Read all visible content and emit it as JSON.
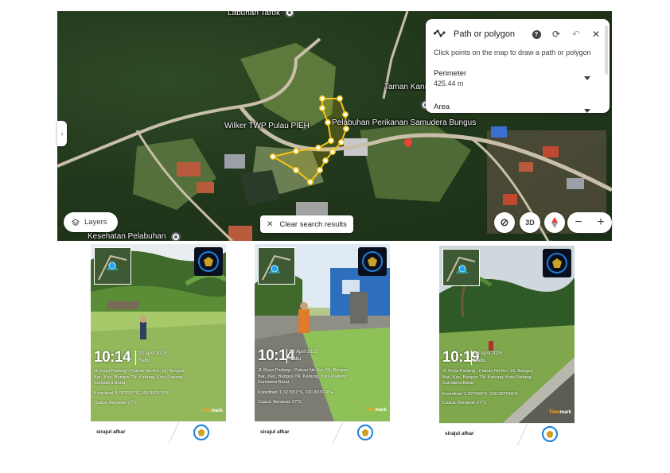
{
  "map": {
    "labels": {
      "labuhan_tarok": "Labuhan Tarok",
      "taman_kana": "Taman Kana",
      "wilker": "Wilker TWP Pulau PIEH",
      "pelabuhan": "Pelabuhan Perikanan Samudera Bungus",
      "kesehatan": "Kesehatan Pelabuhan"
    },
    "measure_panel": {
      "title": "Path or polygon",
      "hint": "Click points on the map to draw a path or polygon",
      "perimeter_label": "Perimeter",
      "perimeter_value": "425.44 m",
      "area_label": "Area"
    },
    "layers_label": "Layers",
    "clear_label": "Clear search results",
    "view_3d_label": "3D",
    "zoom_in": "+",
    "zoom_out": "−",
    "path_color": "#f5c518"
  },
  "cards": [
    {
      "time": "10:14",
      "date": "23 April 2025",
      "day": "Rabu",
      "address": "Jl. Roya Padang - Painan No.Km. 16, Bungus Bar., Kec. Bungus Tlk. Kabung, Kota Padang, Sumatera Barat",
      "coord": "Koordinat: 1.027630°S, 100.397674°E",
      "weather": "Cuaca: Berawan 27°C",
      "timemark": "Timemark",
      "name": "sirajul afkar"
    },
    {
      "time": "10:14",
      "date": "23 April 2025",
      "day": "Rabu",
      "address": "Jl. Roya Padang - Painan No.Km. 16, Bungus Bar., Kec. Bungus Tlk. Kabung, Kota Padang, Sumatera Barat",
      "coord": "Koordinat: 1.027651°S, 100.397674°E",
      "weather": "Cuaca: Berawan 27°C",
      "timemark": "Timemark",
      "name": "sirajul afkar"
    },
    {
      "time": "10:19",
      "date": "23 April 2025",
      "day": "Rabu",
      "address": "Jl. Roya Padang - Painan No.Km. 16, Bungus Bar., Kec. Bungus Tlk. Kabung, Kota Padang, Sumatera Barat",
      "coord": "Koordinat: 1.027458°S, 100.397549°E",
      "weather": "Cuaca: Berawan 27°C",
      "timemark": "Timemark",
      "name": "sirajul afkar"
    }
  ]
}
